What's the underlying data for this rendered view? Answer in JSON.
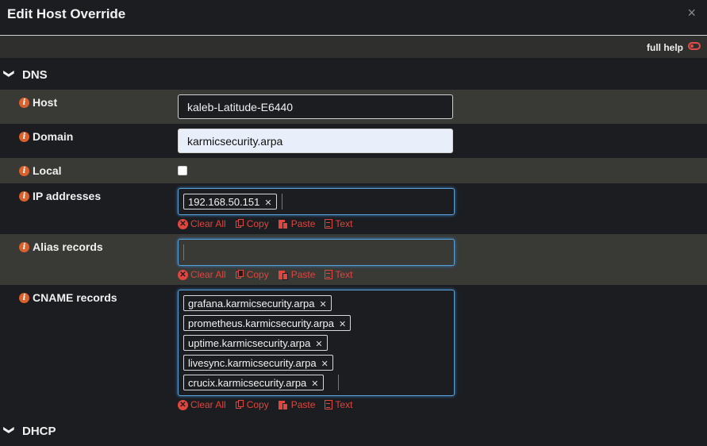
{
  "dialog": {
    "title": "Edit Host Override",
    "close_icon": "close-icon"
  },
  "help": {
    "label": "full help",
    "toggle_icon": "toggle-off-icon"
  },
  "sections": {
    "dns": "DNS",
    "dhcp": "DHCP"
  },
  "fields": {
    "host": {
      "label": "Host",
      "value": "kaleb-Latitude-E6440"
    },
    "domain": {
      "label": "Domain",
      "value": "karmicsecurity.arpa"
    },
    "local": {
      "label": "Local",
      "checked": false
    },
    "ip": {
      "label": "IP addresses",
      "tags": [
        "192.168.50.151"
      ]
    },
    "alias": {
      "label": "Alias records",
      "tags": []
    },
    "cname": {
      "label": "CNAME records",
      "tags": [
        "grafana.karmicsecurity.arpa",
        "prometheus.karmicsecurity.arpa",
        "uptime.karmicsecurity.arpa",
        "livesync.karmicsecurity.arpa",
        "crucix.karmicsecurity.arpa"
      ]
    }
  },
  "actions": {
    "clear": "Clear All",
    "copy": "Copy",
    "paste": "Paste",
    "text": "Text"
  },
  "colors": {
    "accent": "#e0453e",
    "info": "#d9612c",
    "focus": "#5aa0d6"
  }
}
